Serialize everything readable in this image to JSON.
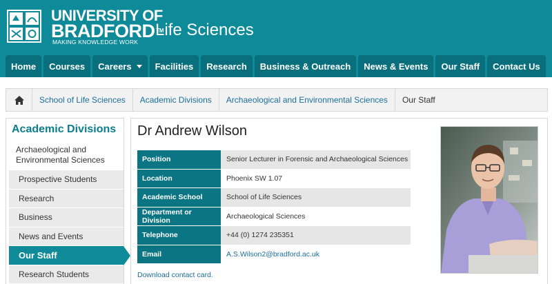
{
  "header": {
    "logo": {
      "line1": "UNIVERSITY OF",
      "line2": "BRADFORD",
      "tm": "TM",
      "tagline": "MAKING KNOWLEDGE WORK"
    },
    "site_title": "Life Sciences",
    "bg_color": "#0e8a99"
  },
  "nav": {
    "items": [
      {
        "label": "Home"
      },
      {
        "label": "Courses"
      },
      {
        "label": "Careers",
        "has_dropdown": true
      },
      {
        "label": "Facilities"
      },
      {
        "label": "Research"
      },
      {
        "label": "Business & Outreach"
      },
      {
        "label": "News & Events"
      },
      {
        "label": "Our Staff"
      },
      {
        "label": "Contact Us"
      }
    ]
  },
  "breadcrumb": {
    "home_icon": "home-icon",
    "items": [
      {
        "label": "School of Life Sciences"
      },
      {
        "label": "Academic Divisions"
      },
      {
        "label": "Archaeological and Environmental Sciences"
      },
      {
        "label": "Our Staff"
      }
    ]
  },
  "sidebar": {
    "title": "Academic Divisions",
    "parent": "Archaeological and Environmental Sciences",
    "items": [
      {
        "label": "Prospective Students"
      },
      {
        "label": "Research"
      },
      {
        "label": "Business"
      },
      {
        "label": "News and Events"
      },
      {
        "label": "Our Staff",
        "active": true
      },
      {
        "label": "Research Students"
      }
    ]
  },
  "main": {
    "title": "Dr Andrew Wilson",
    "info": [
      {
        "label": "Position",
        "value": "Senior Lecturer in Forensic and Archaeological Sciences"
      },
      {
        "label": "Location",
        "value": "Phoenix SW 1.07"
      },
      {
        "label": "Academic School",
        "value": "School of Life Sciences"
      },
      {
        "label": "Department or Division",
        "value": "Archaeological Sciences"
      },
      {
        "label": "Telephone",
        "value": "+44 (0) 1274 235351"
      },
      {
        "label": "Email",
        "value": "A.S.Wilson2@bradford.ac.uk"
      }
    ],
    "download_link": "Download contact card."
  }
}
